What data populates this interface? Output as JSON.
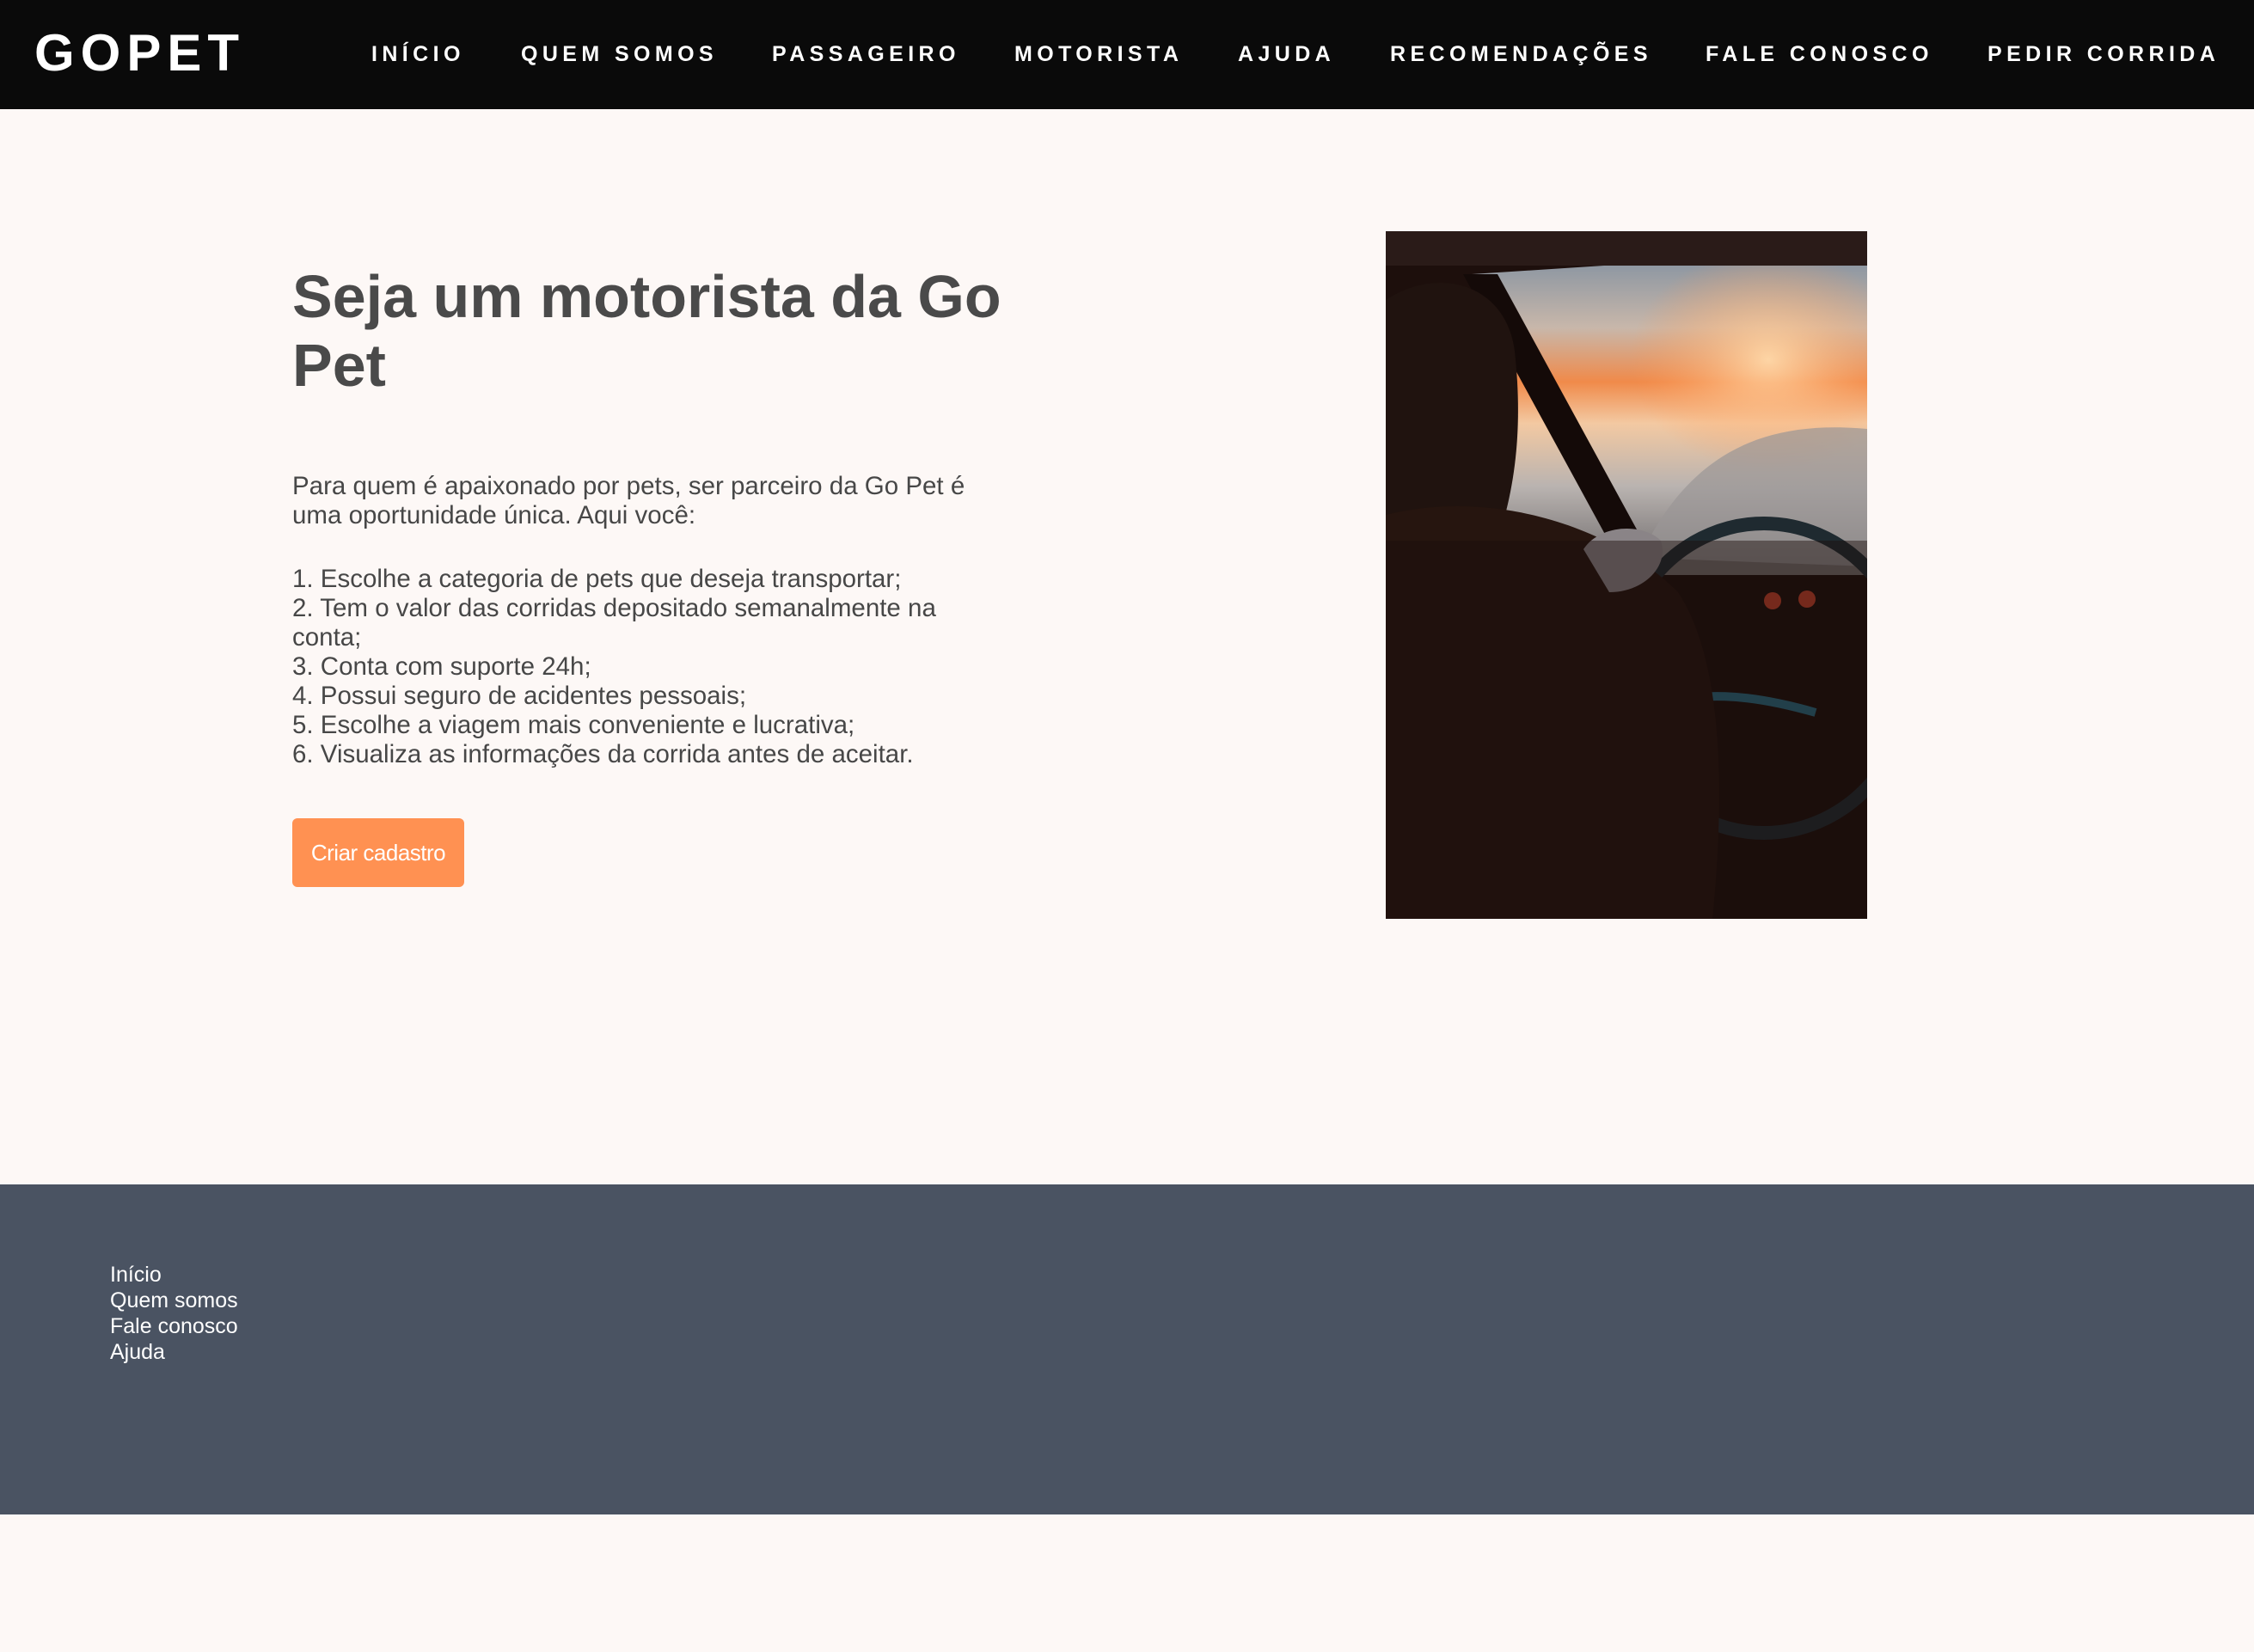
{
  "header": {
    "logo": "GOPET",
    "nav": [
      {
        "label": "INÍCIO"
      },
      {
        "label": "QUEM SOMOS"
      },
      {
        "label": "PASSAGEIRO"
      },
      {
        "label": "MOTORISTA"
      },
      {
        "label": "AJUDA"
      },
      {
        "label": "RECOMENDAÇÕES"
      },
      {
        "label": "FALE CONOSCO"
      },
      {
        "label": "PEDIR CORRIDA"
      }
    ]
  },
  "hero": {
    "title": "Seja um motorista da Go Pet",
    "intro": "Para quem é apaixonado por pets, ser parceiro da Go Pet é uma oportunidade única. Aqui você:",
    "benefits": [
      "1. Escolhe a categoria de pets que deseja transportar;",
      "2. Tem o valor das corridas depositado semanalmente na conta;",
      "3. Conta com suporte 24h;",
      "4. Possui seguro de acidentes pessoais;",
      "5. Escolhe a viagem mais conveniente e lucrativa;",
      "6. Visualiza as informações da corrida antes de aceitar."
    ],
    "cta_label": "Criar cadastro"
  },
  "footer": {
    "links": [
      "Início",
      "Quem somos",
      "Fale conosco",
      "Ajuda"
    ]
  },
  "colors": {
    "header_bg": "#0a0a0a",
    "page_bg": "#fdf8f6",
    "accent": "#ff9152",
    "footer_bg": "#4a5362",
    "text": "#474747"
  }
}
